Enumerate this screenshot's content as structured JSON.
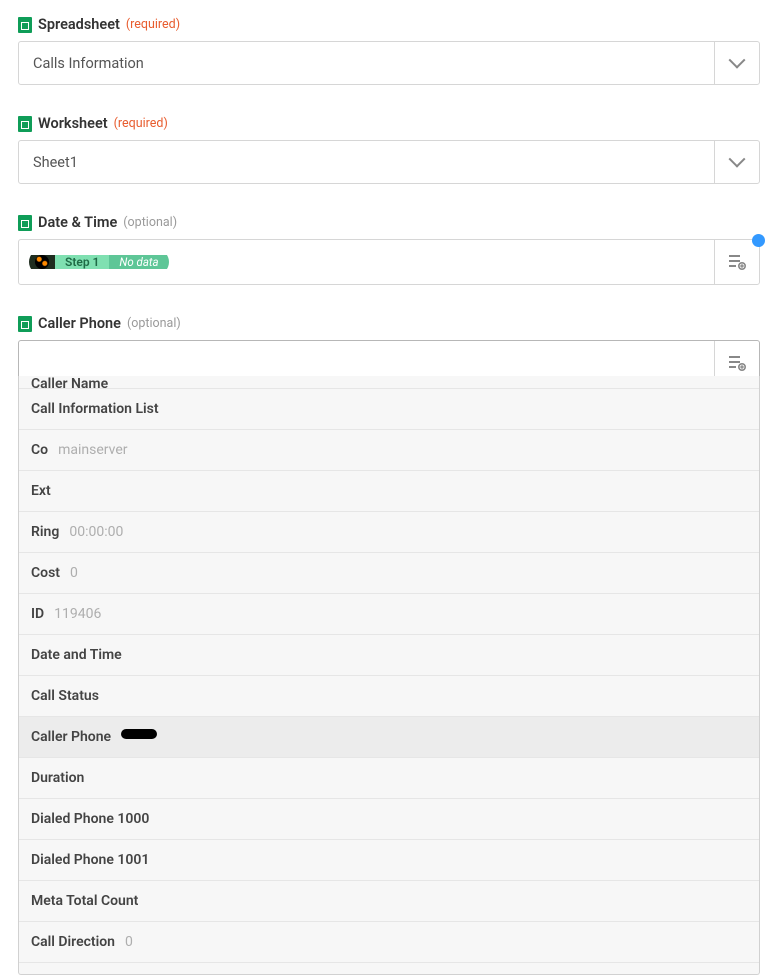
{
  "fields": {
    "spreadsheet": {
      "label": "Spreadsheet",
      "required": "(required)",
      "value": "Calls Information"
    },
    "worksheet": {
      "label": "Worksheet",
      "required": "(required)",
      "value": "Sheet1"
    },
    "dateTime": {
      "label": "Date & Time",
      "optional": "(optional)",
      "pillStep": "Step 1",
      "pillNote": "No data"
    },
    "callerPhone": {
      "label": "Caller Phone",
      "optional": "(optional)"
    }
  },
  "dropdown": {
    "items": [
      {
        "key": "Caller Name",
        "val": ""
      },
      {
        "key": "Call Information List",
        "val": ""
      },
      {
        "key": "Co",
        "val": "mainserver"
      },
      {
        "key": "Ext",
        "val": ""
      },
      {
        "key": "Ring",
        "val": "00:00:00"
      },
      {
        "key": "Cost",
        "val": "0"
      },
      {
        "key": "ID",
        "val": "119406"
      },
      {
        "key": "Date and Time",
        "val": ""
      },
      {
        "key": "Call Status",
        "val": ""
      },
      {
        "key": "Caller Phone",
        "val": "[redacted]"
      },
      {
        "key": "Duration",
        "val": ""
      },
      {
        "key": "Dialed Phone 1000",
        "val": ""
      },
      {
        "key": "Dialed Phone 1001",
        "val": ""
      },
      {
        "key": "Meta Total Count",
        "val": ""
      },
      {
        "key": "Call Direction",
        "val": "0"
      }
    ]
  }
}
